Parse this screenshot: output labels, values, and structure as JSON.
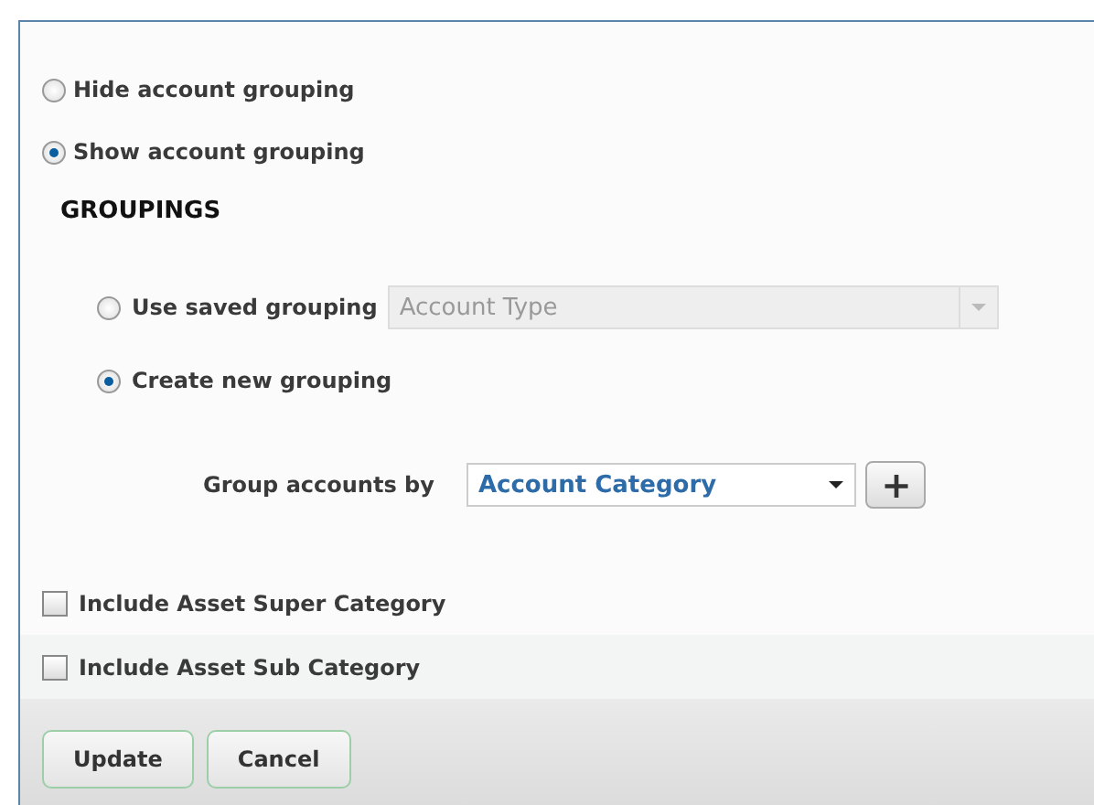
{
  "display_options": [
    {
      "label": "Hide account grouping",
      "selected": false
    },
    {
      "label": "Show account grouping",
      "selected": true
    }
  ],
  "groupings": {
    "heading": "GROUPINGS",
    "sources": [
      {
        "kind": "saved",
        "label": "Use saved grouping",
        "selected": false,
        "select": {
          "value": "Account Type",
          "disabled": true
        }
      },
      {
        "kind": "new",
        "label": "Create new grouping",
        "selected": true
      }
    ],
    "group_by": {
      "label": "Group accounts by",
      "value": "Account Category",
      "add_button": "+"
    }
  },
  "includes": [
    {
      "label": "Include Asset Super Category",
      "checked": false
    },
    {
      "label": "Include Asset Sub Category",
      "checked": false
    }
  ],
  "buttons": [
    "Update",
    "Cancel"
  ]
}
